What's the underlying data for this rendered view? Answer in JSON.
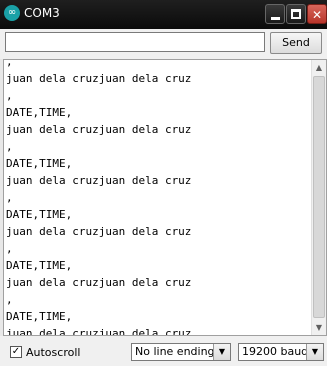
{
  "window": {
    "title": "COM3",
    "app_icon": "arduino-icon",
    "controls": [
      "minimize",
      "maximize",
      "close"
    ]
  },
  "input": {
    "value": "",
    "send_label": "Send"
  },
  "output": {
    "lines": [
      "juan dela cruzjuan dela cruz",
      ",",
      "DATE,TIME,",
      "juan dela cruzjuan dela cruz",
      ",",
      "DATE,TIME,",
      "juan dela cruzjuan dela cruz",
      ",",
      "DATE,TIME,",
      "juan dela cruzjuan dela cruz",
      ",",
      "DATE,TIME,",
      "juan dela cruzjuan dela cruz",
      ",",
      "DATE,TIME,",
      "juan dela cruzjuan dela cruz"
    ]
  },
  "footer": {
    "autoscroll_label": "Autoscroll",
    "autoscroll_checked": true,
    "line_ending": "No line ending",
    "baud_rate": "19200 baud"
  },
  "colors": {
    "titlebar": "#111111",
    "close_button": "#c8473d",
    "app_icon": "#1aa1a7"
  }
}
